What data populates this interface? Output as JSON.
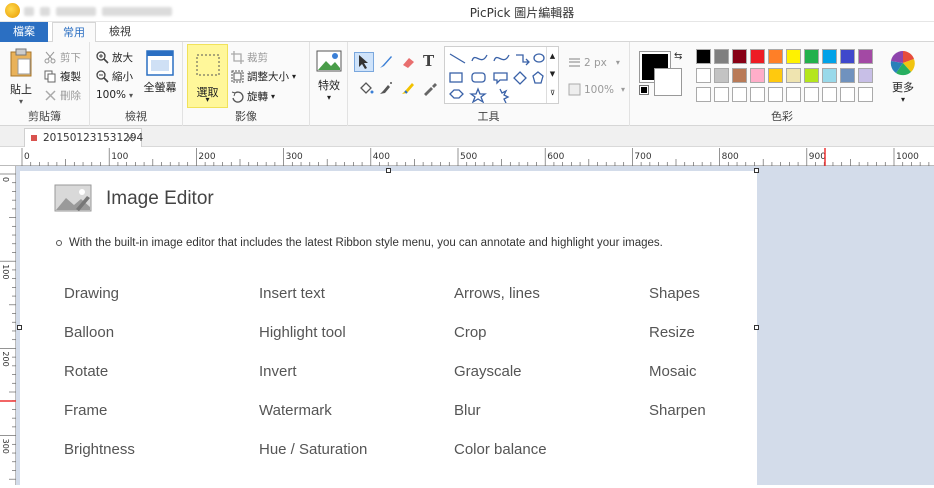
{
  "window": {
    "title": "PicPick 圖片編輯器"
  },
  "tabs": {
    "file": "檔案",
    "home": "常用",
    "view": "檢視"
  },
  "ribbon": {
    "clipboard": {
      "paste": "貼上",
      "cut": "剪下",
      "copy": "複製",
      "delete": "刪除",
      "label": "剪貼簿"
    },
    "view": {
      "zoom_in": "放大",
      "zoom_out": "縮小",
      "zoom_level": "100%",
      "fullscreen": "全螢幕",
      "label": "檢視"
    },
    "image": {
      "select": "選取",
      "crop": "裁剪",
      "resize": "調整大小",
      "rotate": "旋轉",
      "effects": "特效",
      "label": "影像"
    },
    "tools": {
      "text_tool": "T",
      "size": "2 px",
      "opacity": "100%",
      "label": "工具"
    },
    "colors": {
      "label": "色彩",
      "more": "更多",
      "primary": "#000000",
      "secondary": "#ffffff",
      "row1": [
        "#000000",
        "#7f7f7f",
        "#880015",
        "#ed1c24",
        "#ff7f27",
        "#fff200",
        "#22b14c",
        "#00a2e8",
        "#3f48cc",
        "#a349a4"
      ],
      "row2": [
        "#ffffff",
        "#c3c3c3",
        "#b97a57",
        "#ffaec9",
        "#ffc90e",
        "#efe4b0",
        "#b5e61d",
        "#99d9ea",
        "#7092be",
        "#c8bfe7"
      ]
    }
  },
  "document": {
    "tab_name": "201501231531294"
  },
  "ruler": {
    "h_labels": [
      "0",
      "100",
      "200",
      "300",
      "400",
      "500",
      "600",
      "700",
      "800",
      "900",
      "1000"
    ],
    "v_labels": [
      "0",
      "100",
      "200",
      "300"
    ]
  },
  "content": {
    "title": "Image Editor",
    "description": "With the built-in image editor that includes the latest Ribbon style menu, you can annotate and highlight your images.",
    "features": [
      [
        "Drawing",
        "Insert text",
        "Arrows, lines",
        "Shapes"
      ],
      [
        "Balloon",
        "Highlight tool",
        "Crop",
        "Resize"
      ],
      [
        "Rotate",
        "Invert",
        "Grayscale",
        "Mosaic"
      ],
      [
        "Frame",
        "Watermark",
        "Blur",
        "Sharpen"
      ],
      [
        "Brightness",
        "Hue / Saturation",
        "Color balance",
        ""
      ]
    ]
  }
}
